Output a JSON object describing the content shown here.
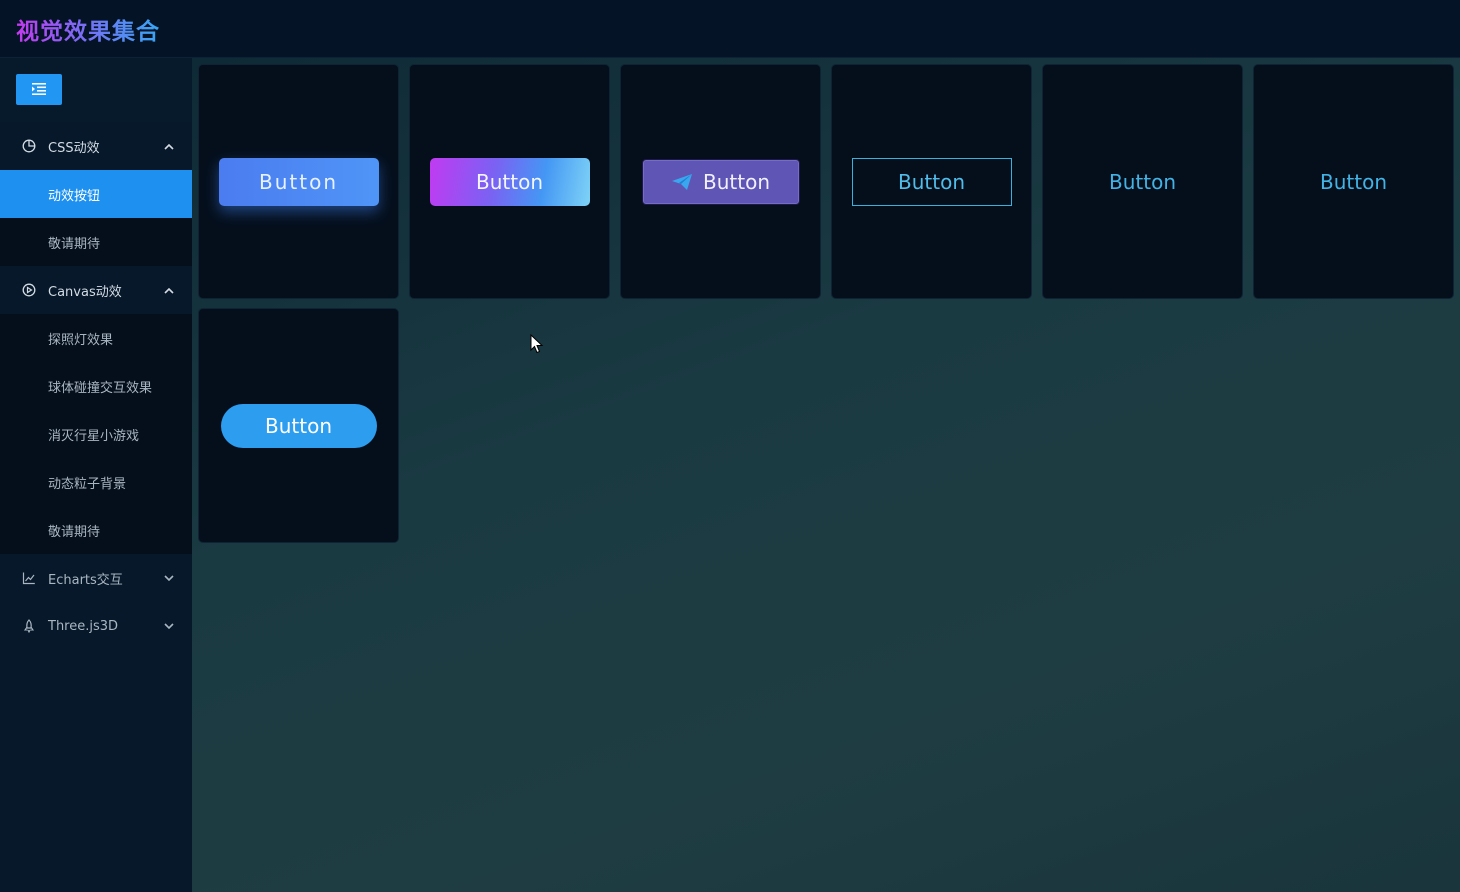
{
  "app": {
    "title": "视觉效果集合"
  },
  "sidebar": {
    "collapse_icon": "menu-fold-icon",
    "groups": [
      {
        "label": "CSS动效",
        "icon": "pie-chart-icon",
        "expanded": true,
        "items": [
          {
            "label": "动效按钮",
            "active": true
          },
          {
            "label": "敬请期待",
            "active": false
          }
        ]
      },
      {
        "label": "Canvas动效",
        "icon": "play-circle-icon",
        "expanded": true,
        "items": [
          {
            "label": "探照灯效果",
            "active": false
          },
          {
            "label": "球体碰撞交互效果",
            "active": false
          },
          {
            "label": "消灭行星小游戏",
            "active": false
          },
          {
            "label": "动态粒子背景",
            "active": false
          },
          {
            "label": "敬请期待",
            "active": false
          }
        ]
      },
      {
        "label": "Echarts交互",
        "icon": "line-chart-icon",
        "expanded": false,
        "items": []
      },
      {
        "label": "Three.js3D",
        "icon": "rocket-icon",
        "expanded": false,
        "items": []
      }
    ]
  },
  "main": {
    "buttons": [
      {
        "label": "Button",
        "style": "gradient-shadow"
      },
      {
        "label": "Button",
        "style": "multicolor-gradient"
      },
      {
        "label": "Button",
        "style": "icon-send",
        "icon": "send-icon"
      },
      {
        "label": "Button",
        "style": "outline"
      },
      {
        "label": "Button",
        "style": "text"
      },
      {
        "label": "Button",
        "style": "text"
      },
      {
        "label": "Button",
        "style": "pill"
      }
    ]
  },
  "colors": {
    "accent": "#1e90f0",
    "sidebar_bg": "#061829",
    "card_bg": "#050f1c",
    "title_gradient_start": "#c43af0",
    "title_gradient_end": "#38a6f4"
  }
}
